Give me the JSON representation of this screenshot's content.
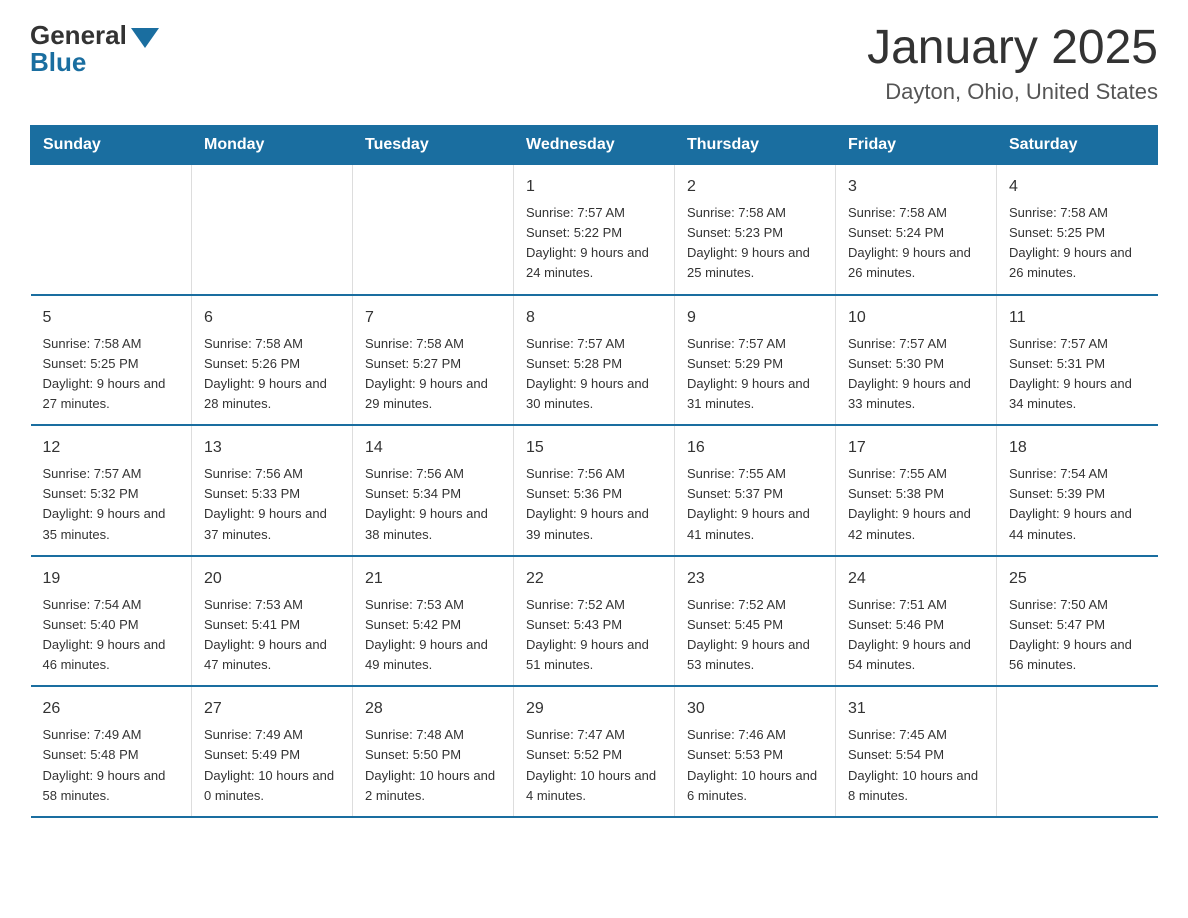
{
  "header": {
    "logo_general": "General",
    "logo_blue": "Blue",
    "month_title": "January 2025",
    "location": "Dayton, Ohio, United States"
  },
  "days_of_week": [
    "Sunday",
    "Monday",
    "Tuesday",
    "Wednesday",
    "Thursday",
    "Friday",
    "Saturday"
  ],
  "weeks": [
    [
      {
        "day": "",
        "info": ""
      },
      {
        "day": "",
        "info": ""
      },
      {
        "day": "",
        "info": ""
      },
      {
        "day": "1",
        "info": "Sunrise: 7:57 AM\nSunset: 5:22 PM\nDaylight: 9 hours\nand 24 minutes."
      },
      {
        "day": "2",
        "info": "Sunrise: 7:58 AM\nSunset: 5:23 PM\nDaylight: 9 hours\nand 25 minutes."
      },
      {
        "day": "3",
        "info": "Sunrise: 7:58 AM\nSunset: 5:24 PM\nDaylight: 9 hours\nand 26 minutes."
      },
      {
        "day": "4",
        "info": "Sunrise: 7:58 AM\nSunset: 5:25 PM\nDaylight: 9 hours\nand 26 minutes."
      }
    ],
    [
      {
        "day": "5",
        "info": "Sunrise: 7:58 AM\nSunset: 5:25 PM\nDaylight: 9 hours\nand 27 minutes."
      },
      {
        "day": "6",
        "info": "Sunrise: 7:58 AM\nSunset: 5:26 PM\nDaylight: 9 hours\nand 28 minutes."
      },
      {
        "day": "7",
        "info": "Sunrise: 7:58 AM\nSunset: 5:27 PM\nDaylight: 9 hours\nand 29 minutes."
      },
      {
        "day": "8",
        "info": "Sunrise: 7:57 AM\nSunset: 5:28 PM\nDaylight: 9 hours\nand 30 minutes."
      },
      {
        "day": "9",
        "info": "Sunrise: 7:57 AM\nSunset: 5:29 PM\nDaylight: 9 hours\nand 31 minutes."
      },
      {
        "day": "10",
        "info": "Sunrise: 7:57 AM\nSunset: 5:30 PM\nDaylight: 9 hours\nand 33 minutes."
      },
      {
        "day": "11",
        "info": "Sunrise: 7:57 AM\nSunset: 5:31 PM\nDaylight: 9 hours\nand 34 minutes."
      }
    ],
    [
      {
        "day": "12",
        "info": "Sunrise: 7:57 AM\nSunset: 5:32 PM\nDaylight: 9 hours\nand 35 minutes."
      },
      {
        "day": "13",
        "info": "Sunrise: 7:56 AM\nSunset: 5:33 PM\nDaylight: 9 hours\nand 37 minutes."
      },
      {
        "day": "14",
        "info": "Sunrise: 7:56 AM\nSunset: 5:34 PM\nDaylight: 9 hours\nand 38 minutes."
      },
      {
        "day": "15",
        "info": "Sunrise: 7:56 AM\nSunset: 5:36 PM\nDaylight: 9 hours\nand 39 minutes."
      },
      {
        "day": "16",
        "info": "Sunrise: 7:55 AM\nSunset: 5:37 PM\nDaylight: 9 hours\nand 41 minutes."
      },
      {
        "day": "17",
        "info": "Sunrise: 7:55 AM\nSunset: 5:38 PM\nDaylight: 9 hours\nand 42 minutes."
      },
      {
        "day": "18",
        "info": "Sunrise: 7:54 AM\nSunset: 5:39 PM\nDaylight: 9 hours\nand 44 minutes."
      }
    ],
    [
      {
        "day": "19",
        "info": "Sunrise: 7:54 AM\nSunset: 5:40 PM\nDaylight: 9 hours\nand 46 minutes."
      },
      {
        "day": "20",
        "info": "Sunrise: 7:53 AM\nSunset: 5:41 PM\nDaylight: 9 hours\nand 47 minutes."
      },
      {
        "day": "21",
        "info": "Sunrise: 7:53 AM\nSunset: 5:42 PM\nDaylight: 9 hours\nand 49 minutes."
      },
      {
        "day": "22",
        "info": "Sunrise: 7:52 AM\nSunset: 5:43 PM\nDaylight: 9 hours\nand 51 minutes."
      },
      {
        "day": "23",
        "info": "Sunrise: 7:52 AM\nSunset: 5:45 PM\nDaylight: 9 hours\nand 53 minutes."
      },
      {
        "day": "24",
        "info": "Sunrise: 7:51 AM\nSunset: 5:46 PM\nDaylight: 9 hours\nand 54 minutes."
      },
      {
        "day": "25",
        "info": "Sunrise: 7:50 AM\nSunset: 5:47 PM\nDaylight: 9 hours\nand 56 minutes."
      }
    ],
    [
      {
        "day": "26",
        "info": "Sunrise: 7:49 AM\nSunset: 5:48 PM\nDaylight: 9 hours\nand 58 minutes."
      },
      {
        "day": "27",
        "info": "Sunrise: 7:49 AM\nSunset: 5:49 PM\nDaylight: 10 hours\nand 0 minutes."
      },
      {
        "day": "28",
        "info": "Sunrise: 7:48 AM\nSunset: 5:50 PM\nDaylight: 10 hours\nand 2 minutes."
      },
      {
        "day": "29",
        "info": "Sunrise: 7:47 AM\nSunset: 5:52 PM\nDaylight: 10 hours\nand 4 minutes."
      },
      {
        "day": "30",
        "info": "Sunrise: 7:46 AM\nSunset: 5:53 PM\nDaylight: 10 hours\nand 6 minutes."
      },
      {
        "day": "31",
        "info": "Sunrise: 7:45 AM\nSunset: 5:54 PM\nDaylight: 10 hours\nand 8 minutes."
      },
      {
        "day": "",
        "info": ""
      }
    ]
  ]
}
